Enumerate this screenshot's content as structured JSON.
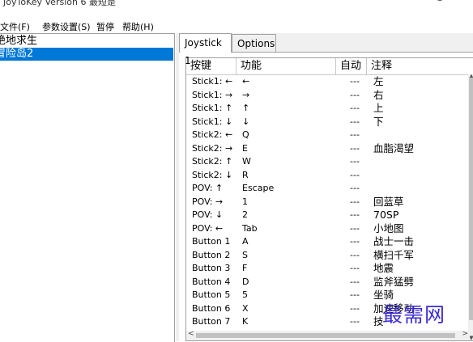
{
  "window": {
    "title": "JoyToKey Version 6 最短是"
  },
  "menu": [
    {
      "label": "文件(F)"
    },
    {
      "label": "参数设置(S)"
    },
    {
      "label": "暂停"
    },
    {
      "label": "帮助(H)"
    }
  ],
  "profiles": [
    {
      "label": "绝地求生"
    },
    {
      "label": "冒险岛2"
    }
  ],
  "tabs": [
    {
      "label": "Joystick 1"
    },
    {
      "label": "Options"
    }
  ],
  "grid": {
    "columns": [
      "按键",
      "功能",
      "自动",
      "注释"
    ],
    "rows": [
      {
        "key": "Stick1: ←",
        "func": "←",
        "auto": "---",
        "note": "左"
      },
      {
        "key": "Stick1: →",
        "func": "→",
        "auto": "---",
        "note": "右"
      },
      {
        "key": "Stick1: ↑",
        "func": "↑",
        "auto": "---",
        "note": "上"
      },
      {
        "key": "Stick1: ↓",
        "func": "↓",
        "auto": "---",
        "note": "下"
      },
      {
        "key": "Stick2: ←",
        "func": "Q",
        "auto": "---",
        "note": ""
      },
      {
        "key": "Stick2: →",
        "func": "E",
        "auto": "---",
        "note": "血脂渴望"
      },
      {
        "key": "Stick2: ↑",
        "func": "W",
        "auto": "---",
        "note": ""
      },
      {
        "key": "Stick2: ↓",
        "func": "R",
        "auto": "---",
        "note": ""
      },
      {
        "key": "POV: ↑",
        "func": "Escape",
        "auto": "---",
        "note": ""
      },
      {
        "key": "POV: →",
        "func": "1",
        "auto": "---",
        "note": "回蓝草"
      },
      {
        "key": "POV: ↓",
        "func": "2",
        "auto": "---",
        "note": "70SP"
      },
      {
        "key": "POV: ←",
        "func": "Tab",
        "auto": "---",
        "note": "小地图"
      },
      {
        "key": "Button 1",
        "func": "A",
        "auto": "---",
        "note": "战士一击"
      },
      {
        "key": "Button 2",
        "func": "S",
        "auto": "---",
        "note": "横扫千军"
      },
      {
        "key": "Button 3",
        "func": "F",
        "auto": "---",
        "note": "地震"
      },
      {
        "key": "Button 4",
        "func": "D",
        "auto": "---",
        "note": "监斧猛劈"
      },
      {
        "key": "Button 5",
        "func": "5",
        "auto": "---",
        "note": "坐骑"
      },
      {
        "key": "Button 6",
        "func": "X",
        "auto": "---",
        "note": "加速移动"
      },
      {
        "key": "Button 7",
        "func": "K",
        "auto": "---",
        "note": "技"
      }
    ]
  },
  "watermark": {
    "text": "最需网"
  },
  "colors": {
    "selection": "#0078d7",
    "watermark": "#3b2bd6"
  }
}
